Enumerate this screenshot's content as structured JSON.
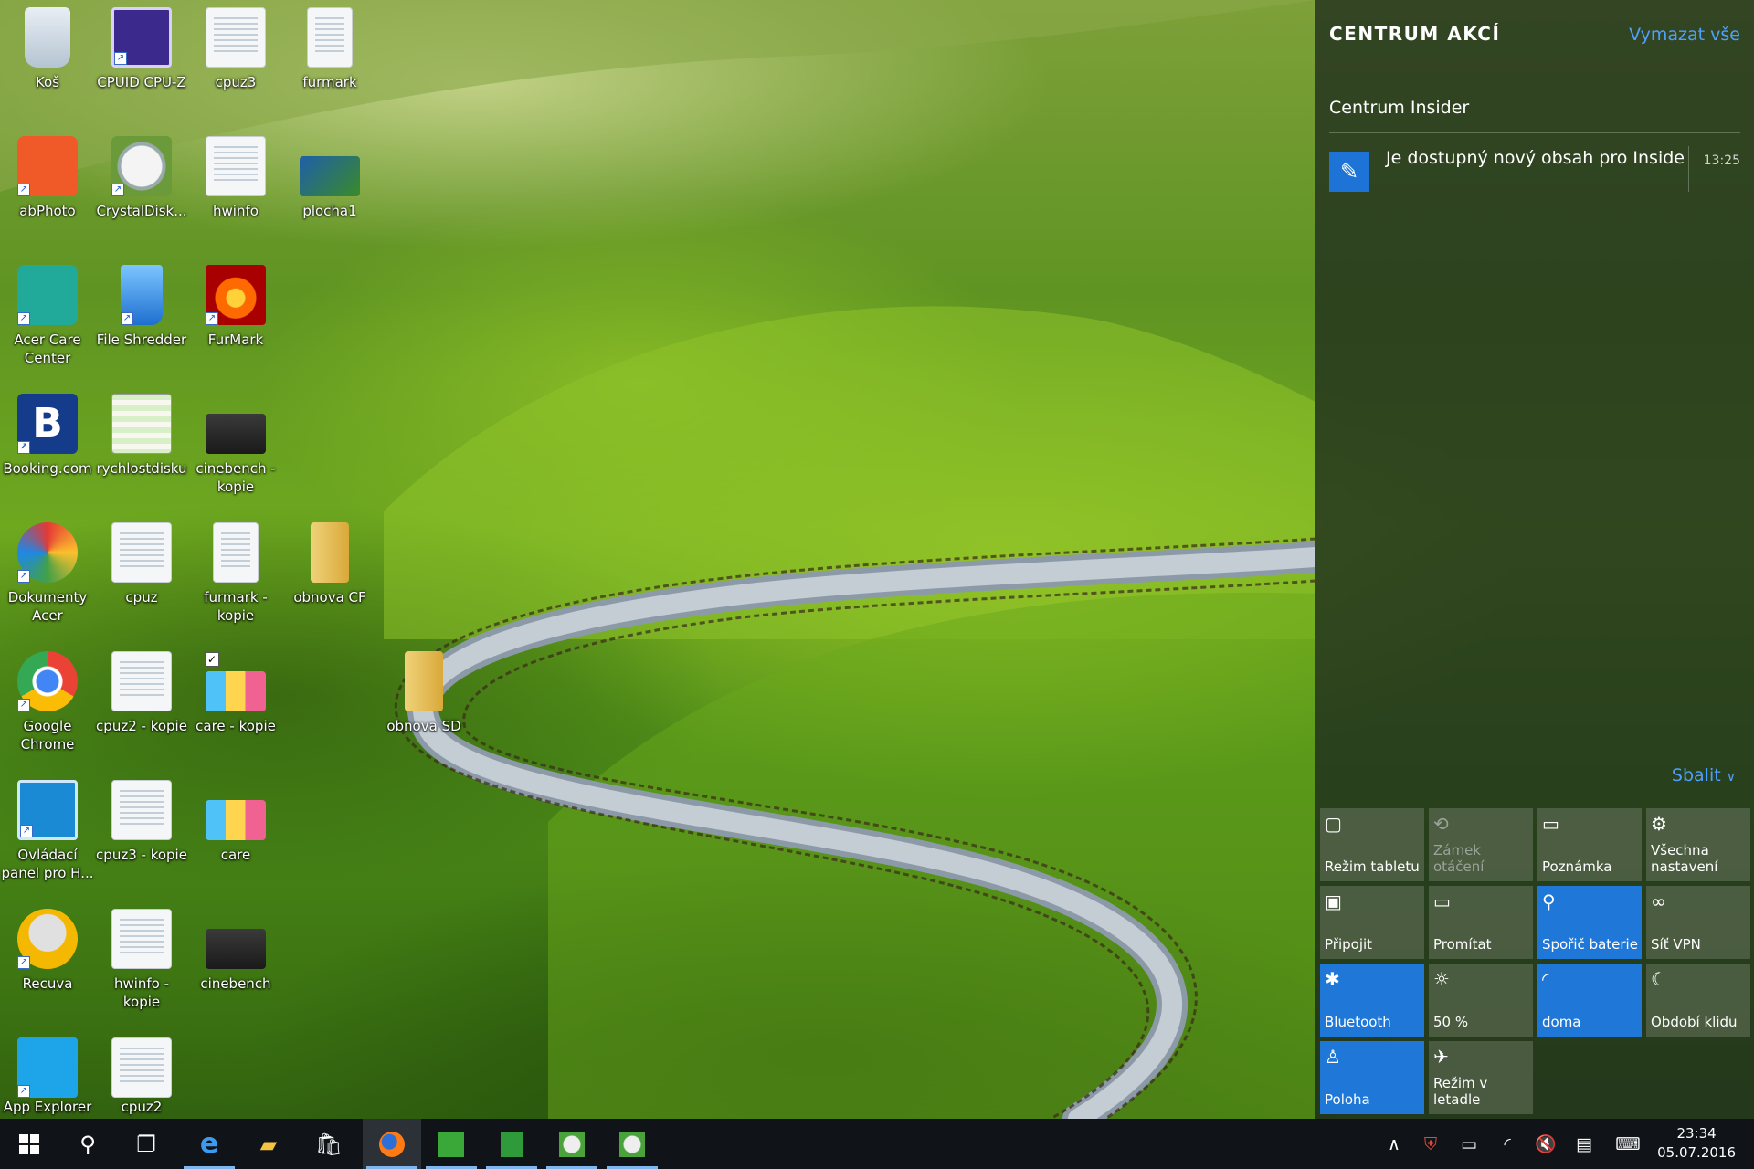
{
  "desktop": {
    "icons": [
      {
        "label": "Koš"
      },
      {
        "label": "CPUID CPU-Z"
      },
      {
        "label": "cpuz3"
      },
      {
        "label": "furmark"
      },
      {
        "label": "abPhoto"
      },
      {
        "label": "CrystalDisk..."
      },
      {
        "label": "hwinfo"
      },
      {
        "label": "plocha1"
      },
      {
        "label": "Acer Care Center"
      },
      {
        "label": "File Shredder"
      },
      {
        "label": "FurMark"
      },
      {
        "label": "Booking.com"
      },
      {
        "label": "rychlostdisku"
      },
      {
        "label": "cinebench - kopie"
      },
      {
        "label": "Dokumenty Acer"
      },
      {
        "label": "cpuz"
      },
      {
        "label": "furmark - kopie"
      },
      {
        "label": "obnova CF"
      },
      {
        "label": "Google Chrome"
      },
      {
        "label": "cpuz2 - kopie"
      },
      {
        "label": "care - kopie"
      },
      {
        "label": "obnova SD"
      },
      {
        "label": "Ovládací panel pro H..."
      },
      {
        "label": "cpuz3 - kopie"
      },
      {
        "label": "care"
      },
      {
        "label": "Recuva"
      },
      {
        "label": "hwinfo - kopie"
      },
      {
        "label": "cinebench"
      },
      {
        "label": "App Explorer"
      },
      {
        "label": "cpuz2"
      }
    ]
  },
  "action_center": {
    "title": "CENTRUM AKCÍ",
    "clear_all": "Vymazat vše",
    "group_title": "Centrum Insider",
    "notification": {
      "text": "Je dostupný nový obsah pro Inside",
      "time": "13:25"
    },
    "collapse": "Sbalit",
    "tiles": [
      {
        "label": "Režim tabletu",
        "icon": "▢",
        "state": "off"
      },
      {
        "label": "Zámek otáčení",
        "icon": "⟲",
        "state": "disabled"
      },
      {
        "label": "Poznámka",
        "icon": "▭",
        "state": "off"
      },
      {
        "label": "Všechna nastavení",
        "icon": "⚙",
        "state": "off"
      },
      {
        "label": "Připojit",
        "icon": "▣",
        "state": "off"
      },
      {
        "label": "Promítat",
        "icon": "▭",
        "state": "off"
      },
      {
        "label": "Spořič baterie",
        "icon": "⚲",
        "state": "on"
      },
      {
        "label": "Síť VPN",
        "icon": "∞",
        "state": "off"
      },
      {
        "label": "Bluetooth",
        "icon": "✱",
        "state": "on"
      },
      {
        "label": "50 %",
        "icon": "☼",
        "state": "off"
      },
      {
        "label": "doma",
        "icon": "◜",
        "state": "on"
      },
      {
        "label": "Období klidu",
        "icon": "☾",
        "state": "off"
      },
      {
        "label": "Poloha",
        "icon": "♙",
        "state": "on"
      },
      {
        "label": "Režim v letadle",
        "icon": "✈",
        "state": "off"
      }
    ]
  },
  "taskbar": {
    "clock_time": "23:34",
    "clock_date": "05.07.2016"
  }
}
